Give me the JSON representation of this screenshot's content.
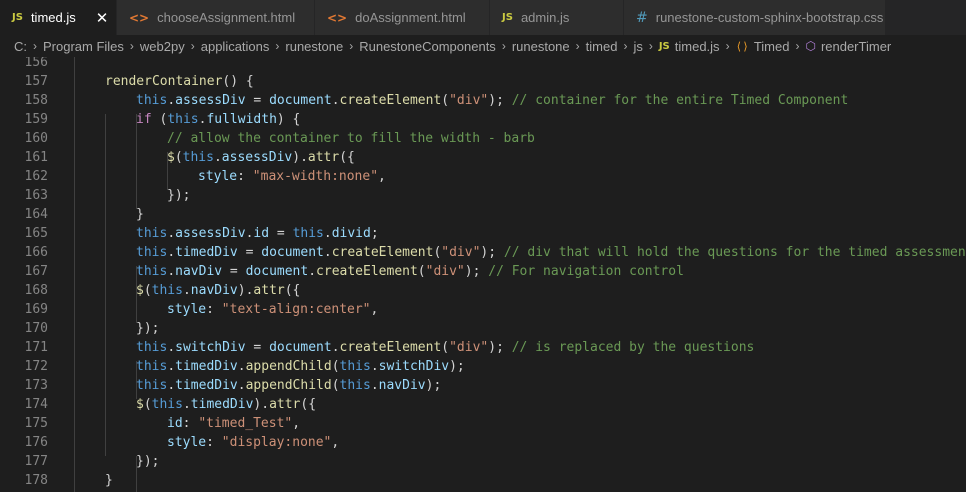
{
  "tabs": [
    {
      "icon": "JS",
      "icon_kind": "js",
      "label": "timed.js",
      "active": true,
      "close": "✕"
    },
    {
      "icon": "<>",
      "icon_kind": "html",
      "label": "chooseAssignment.html"
    },
    {
      "icon": "<>",
      "icon_kind": "html",
      "label": "doAssignment.html"
    },
    {
      "icon": "JS",
      "icon_kind": "js",
      "label": "admin.js"
    },
    {
      "icon": "#",
      "icon_kind": "css",
      "label": "runestone-custom-sphinx-bootstrap.css"
    }
  ],
  "breadcrumb": {
    "parts": [
      "C:",
      "Program Files",
      "web2py",
      "applications",
      "runestone",
      "RunestoneComponents",
      "runestone",
      "timed",
      "js"
    ],
    "file_icon": "JS",
    "file": "timed.js",
    "class": "Timed",
    "method": "renderTimer"
  },
  "lines": [
    {
      "n": "156",
      "indent": 0,
      "tokens": []
    },
    {
      "n": "157",
      "indent": 1,
      "tokens": [
        [
          "fn",
          "renderContainer"
        ],
        [
          "p",
          "() {"
        ]
      ]
    },
    {
      "n": "158",
      "indent": 2,
      "tokens": [
        [
          "kw",
          "this"
        ],
        [
          "p",
          "."
        ],
        [
          "pr",
          "assessDiv"
        ],
        [
          "p",
          " = "
        ],
        [
          "vr",
          "document"
        ],
        [
          "p",
          "."
        ],
        [
          "fn",
          "createElement"
        ],
        [
          "p",
          "("
        ],
        [
          "st",
          "\"div\""
        ],
        [
          "p",
          "); "
        ],
        [
          "cm",
          "// container for the entire Timed Component"
        ]
      ]
    },
    {
      "n": "159",
      "indent": 2,
      "tokens": [
        [
          "kc",
          "if"
        ],
        [
          "p",
          " ("
        ],
        [
          "kw",
          "this"
        ],
        [
          "p",
          "."
        ],
        [
          "pr",
          "fullwidth"
        ],
        [
          "p",
          ") {"
        ]
      ]
    },
    {
      "n": "160",
      "indent": 3,
      "tokens": [
        [
          "cm",
          "// allow the container to fill the width - barb"
        ]
      ]
    },
    {
      "n": "161",
      "indent": 3,
      "tokens": [
        [
          "fn",
          "$"
        ],
        [
          "p",
          "("
        ],
        [
          "kw",
          "this"
        ],
        [
          "p",
          "."
        ],
        [
          "pr",
          "assessDiv"
        ],
        [
          "p",
          ")."
        ],
        [
          "fn",
          "attr"
        ],
        [
          "p",
          "({"
        ]
      ]
    },
    {
      "n": "162",
      "indent": 4,
      "tokens": [
        [
          "pr",
          "style"
        ],
        [
          "p",
          ": "
        ],
        [
          "st",
          "\"max-width:none\""
        ],
        [
          "p",
          ","
        ]
      ]
    },
    {
      "n": "163",
      "indent": 3,
      "tokens": [
        [
          "p",
          "});"
        ]
      ]
    },
    {
      "n": "164",
      "indent": 2,
      "tokens": [
        [
          "p",
          "}"
        ]
      ]
    },
    {
      "n": "165",
      "indent": 2,
      "tokens": [
        [
          "kw",
          "this"
        ],
        [
          "p",
          "."
        ],
        [
          "pr",
          "assessDiv"
        ],
        [
          "p",
          "."
        ],
        [
          "pr",
          "id"
        ],
        [
          "p",
          " = "
        ],
        [
          "kw",
          "this"
        ],
        [
          "p",
          "."
        ],
        [
          "pr",
          "divid"
        ],
        [
          "p",
          ";"
        ]
      ]
    },
    {
      "n": "166",
      "indent": 2,
      "tokens": [
        [
          "kw",
          "this"
        ],
        [
          "p",
          "."
        ],
        [
          "pr",
          "timedDiv"
        ],
        [
          "p",
          " = "
        ],
        [
          "vr",
          "document"
        ],
        [
          "p",
          "."
        ],
        [
          "fn",
          "createElement"
        ],
        [
          "p",
          "("
        ],
        [
          "st",
          "\"div\""
        ],
        [
          "p",
          "); "
        ],
        [
          "cm",
          "// div that will hold the questions for the timed assessment"
        ]
      ]
    },
    {
      "n": "167",
      "indent": 2,
      "tokens": [
        [
          "kw",
          "this"
        ],
        [
          "p",
          "."
        ],
        [
          "pr",
          "navDiv"
        ],
        [
          "p",
          " = "
        ],
        [
          "vr",
          "document"
        ],
        [
          "p",
          "."
        ],
        [
          "fn",
          "createElement"
        ],
        [
          "p",
          "("
        ],
        [
          "st",
          "\"div\""
        ],
        [
          "p",
          "); "
        ],
        [
          "cm",
          "// For navigation control"
        ]
      ]
    },
    {
      "n": "168",
      "indent": 2,
      "tokens": [
        [
          "fn",
          "$"
        ],
        [
          "p",
          "("
        ],
        [
          "kw",
          "this"
        ],
        [
          "p",
          "."
        ],
        [
          "pr",
          "navDiv"
        ],
        [
          "p",
          ")."
        ],
        [
          "fn",
          "attr"
        ],
        [
          "p",
          "({"
        ]
      ]
    },
    {
      "n": "169",
      "indent": 3,
      "tokens": [
        [
          "pr",
          "style"
        ],
        [
          "p",
          ": "
        ],
        [
          "st",
          "\"text-align:center\""
        ],
        [
          "p",
          ","
        ]
      ]
    },
    {
      "n": "170",
      "indent": 2,
      "tokens": [
        [
          "p",
          "});"
        ]
      ]
    },
    {
      "n": "171",
      "indent": 2,
      "tokens": [
        [
          "kw",
          "this"
        ],
        [
          "p",
          "."
        ],
        [
          "pr",
          "switchDiv"
        ],
        [
          "p",
          " = "
        ],
        [
          "vr",
          "document"
        ],
        [
          "p",
          "."
        ],
        [
          "fn",
          "createElement"
        ],
        [
          "p",
          "("
        ],
        [
          "st",
          "\"div\""
        ],
        [
          "p",
          "); "
        ],
        [
          "cm",
          "// is replaced by the questions"
        ]
      ]
    },
    {
      "n": "172",
      "indent": 2,
      "tokens": [
        [
          "kw",
          "this"
        ],
        [
          "p",
          "."
        ],
        [
          "pr",
          "timedDiv"
        ],
        [
          "p",
          "."
        ],
        [
          "fn",
          "appendChild"
        ],
        [
          "p",
          "("
        ],
        [
          "kw",
          "this"
        ],
        [
          "p",
          "."
        ],
        [
          "pr",
          "switchDiv"
        ],
        [
          "p",
          ");"
        ]
      ]
    },
    {
      "n": "173",
      "indent": 2,
      "tokens": [
        [
          "kw",
          "this"
        ],
        [
          "p",
          "."
        ],
        [
          "pr",
          "timedDiv"
        ],
        [
          "p",
          "."
        ],
        [
          "fn",
          "appendChild"
        ],
        [
          "p",
          "("
        ],
        [
          "kw",
          "this"
        ],
        [
          "p",
          "."
        ],
        [
          "pr",
          "navDiv"
        ],
        [
          "p",
          ");"
        ]
      ]
    },
    {
      "n": "174",
      "indent": 2,
      "tokens": [
        [
          "fn",
          "$"
        ],
        [
          "p",
          "("
        ],
        [
          "kw",
          "this"
        ],
        [
          "p",
          "."
        ],
        [
          "pr",
          "timedDiv"
        ],
        [
          "p",
          ")."
        ],
        [
          "fn",
          "attr"
        ],
        [
          "p",
          "({"
        ]
      ]
    },
    {
      "n": "175",
      "indent": 3,
      "tokens": [
        [
          "pr",
          "id"
        ],
        [
          "p",
          ": "
        ],
        [
          "st",
          "\"timed_Test\""
        ],
        [
          "p",
          ","
        ]
      ]
    },
    {
      "n": "176",
      "indent": 3,
      "tokens": [
        [
          "pr",
          "style"
        ],
        [
          "p",
          ": "
        ],
        [
          "st",
          "\"display:none\""
        ],
        [
          "p",
          ","
        ]
      ]
    },
    {
      "n": "177",
      "indent": 2,
      "tokens": [
        [
          "p",
          "});"
        ]
      ]
    },
    {
      "n": "178",
      "indent": 1,
      "tokens": [
        [
          "p",
          "}"
        ]
      ]
    }
  ],
  "colors": {
    "background": "#1e1e1e",
    "keyword": "#569cd6",
    "control": "#c586c0",
    "function": "#dcdcaa",
    "property": "#9cdcfe",
    "string": "#ce9178",
    "comment": "#6a9955",
    "line_number": "#858585"
  }
}
